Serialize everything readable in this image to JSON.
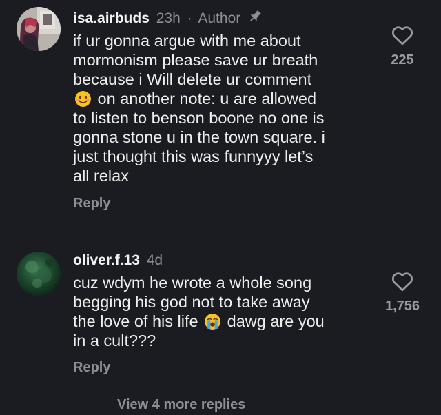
{
  "comments": [
    {
      "username": "isa.airbuds",
      "time": "23h",
      "separator": "·",
      "badge": "Author",
      "lines": [
        "if ur gonna argue with me about",
        "mormonism please save ur breath",
        "because i Will delete ur comment",
        "on another note: u are allowed",
        "to listen to benson boone no one is",
        "gonna stone u in the town square. i",
        "just thought this was funnyyy let’s",
        "all relax"
      ],
      "emoji": "smiling-face-emoji",
      "reply": "Reply",
      "likes": "225",
      "icons": {
        "pin": "pin-icon",
        "heart": "heart-outline-icon"
      }
    },
    {
      "username": "oliver.f.13",
      "time": "4d",
      "lines": [
        "cuz wdym he wrote a whole song",
        "begging his god not to take away",
        "the love of his life",
        "dawg are you",
        "in a cult???"
      ],
      "emoji": "loudly-crying-face-emoji",
      "reply": "Reply",
      "likes": "1,756",
      "icons": {
        "heart": "heart-outline-icon"
      }
    }
  ],
  "view_more": "View 4 more replies",
  "colors": {
    "background": "#1b1c21",
    "text": "#eeeeee",
    "muted": "#8e8f96"
  }
}
